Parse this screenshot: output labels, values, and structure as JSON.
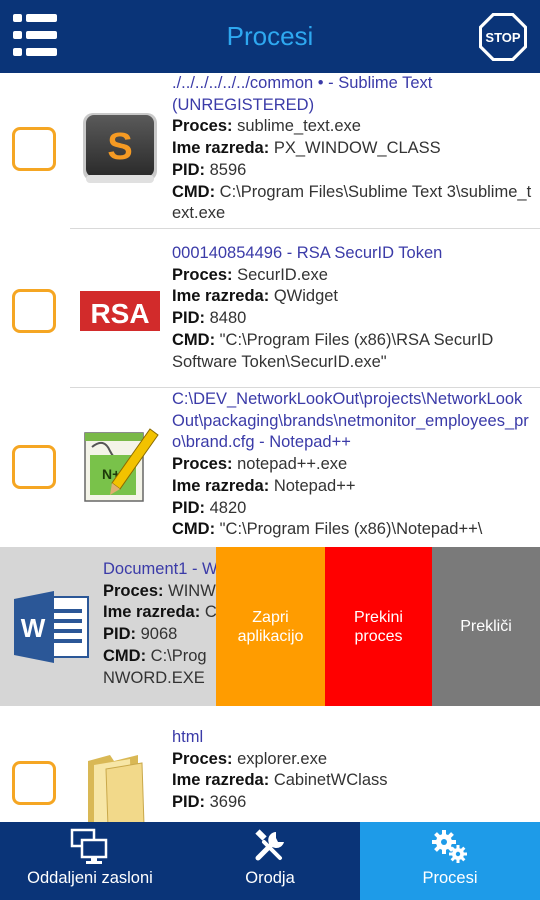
{
  "header": {
    "title": "Procesi",
    "stop_label": "STOP"
  },
  "labels": {
    "proces": "Proces:",
    "ime_razreda": "Ime razreda:",
    "pid": "PID:",
    "cmd": "CMD:"
  },
  "items": [
    {
      "title": "./../../../../../common • - Sublime Text (UNREGISTERED)",
      "proces": "sublime_text.exe",
      "ime_razreda": "PX_WINDOW_CLASS",
      "pid": "8596",
      "cmd": "C:\\Program Files\\Sublime Text 3\\sublime_text.exe",
      "icon": "sublime-text-icon"
    },
    {
      "title": "000140854496 - RSA SecurID Token",
      "proces": "SecurID.exe",
      "ime_razreda": "QWidget",
      "pid": "8480",
      "cmd": "\"C:\\Program Files (x86)\\RSA SecurID Software Token\\SecurID.exe\"",
      "icon": "rsa-icon",
      "icon_text": "RSA"
    },
    {
      "title": "C:\\DEV_NetworkLookOut\\projects\\NetworkLookOut\\packaging\\brands\\netmonitor_employees_pro\\brand.cfg - Notepad++",
      "proces": "notepad++.exe",
      "ime_razreda": "Notepad++",
      "pid": "4820",
      "cmd": "\"C:\\Program Files (x86)\\Notepad++\\",
      "icon": "notepad-plus-plus-icon"
    },
    {
      "title": "Document1 - W",
      "proces": "WINW",
      "ime_razreda": "C",
      "pid": "9068",
      "cmd": "C:\\Prog",
      "cmd_cont": "NWORD.EXE",
      "icon": "word-icon"
    },
    {
      "title": "html",
      "proces": "explorer.exe",
      "ime_razreda": "CabinetWClass",
      "pid": "3696",
      "icon": "folder-icon"
    }
  ],
  "swipe_actions": {
    "close_app": "Zapri aplikacijo",
    "kill_process": "Prekini proces",
    "cancel": "Prekliči"
  },
  "nav": {
    "tabs": [
      {
        "label": "Oddaljeni zasloni",
        "icon": "monitors-icon"
      },
      {
        "label": "Orodja",
        "icon": "tools-icon"
      },
      {
        "label": "Procesi",
        "icon": "gears-icon",
        "active": true
      }
    ]
  },
  "colors": {
    "header_bg": "#0a3478",
    "title_color": "#2ea8f0",
    "checkbox_border": "#f5a623",
    "action_orange": "#ff9c00",
    "action_red": "#ff0000",
    "action_gray": "#7a7a7a",
    "nav_active": "#1e9be8"
  }
}
